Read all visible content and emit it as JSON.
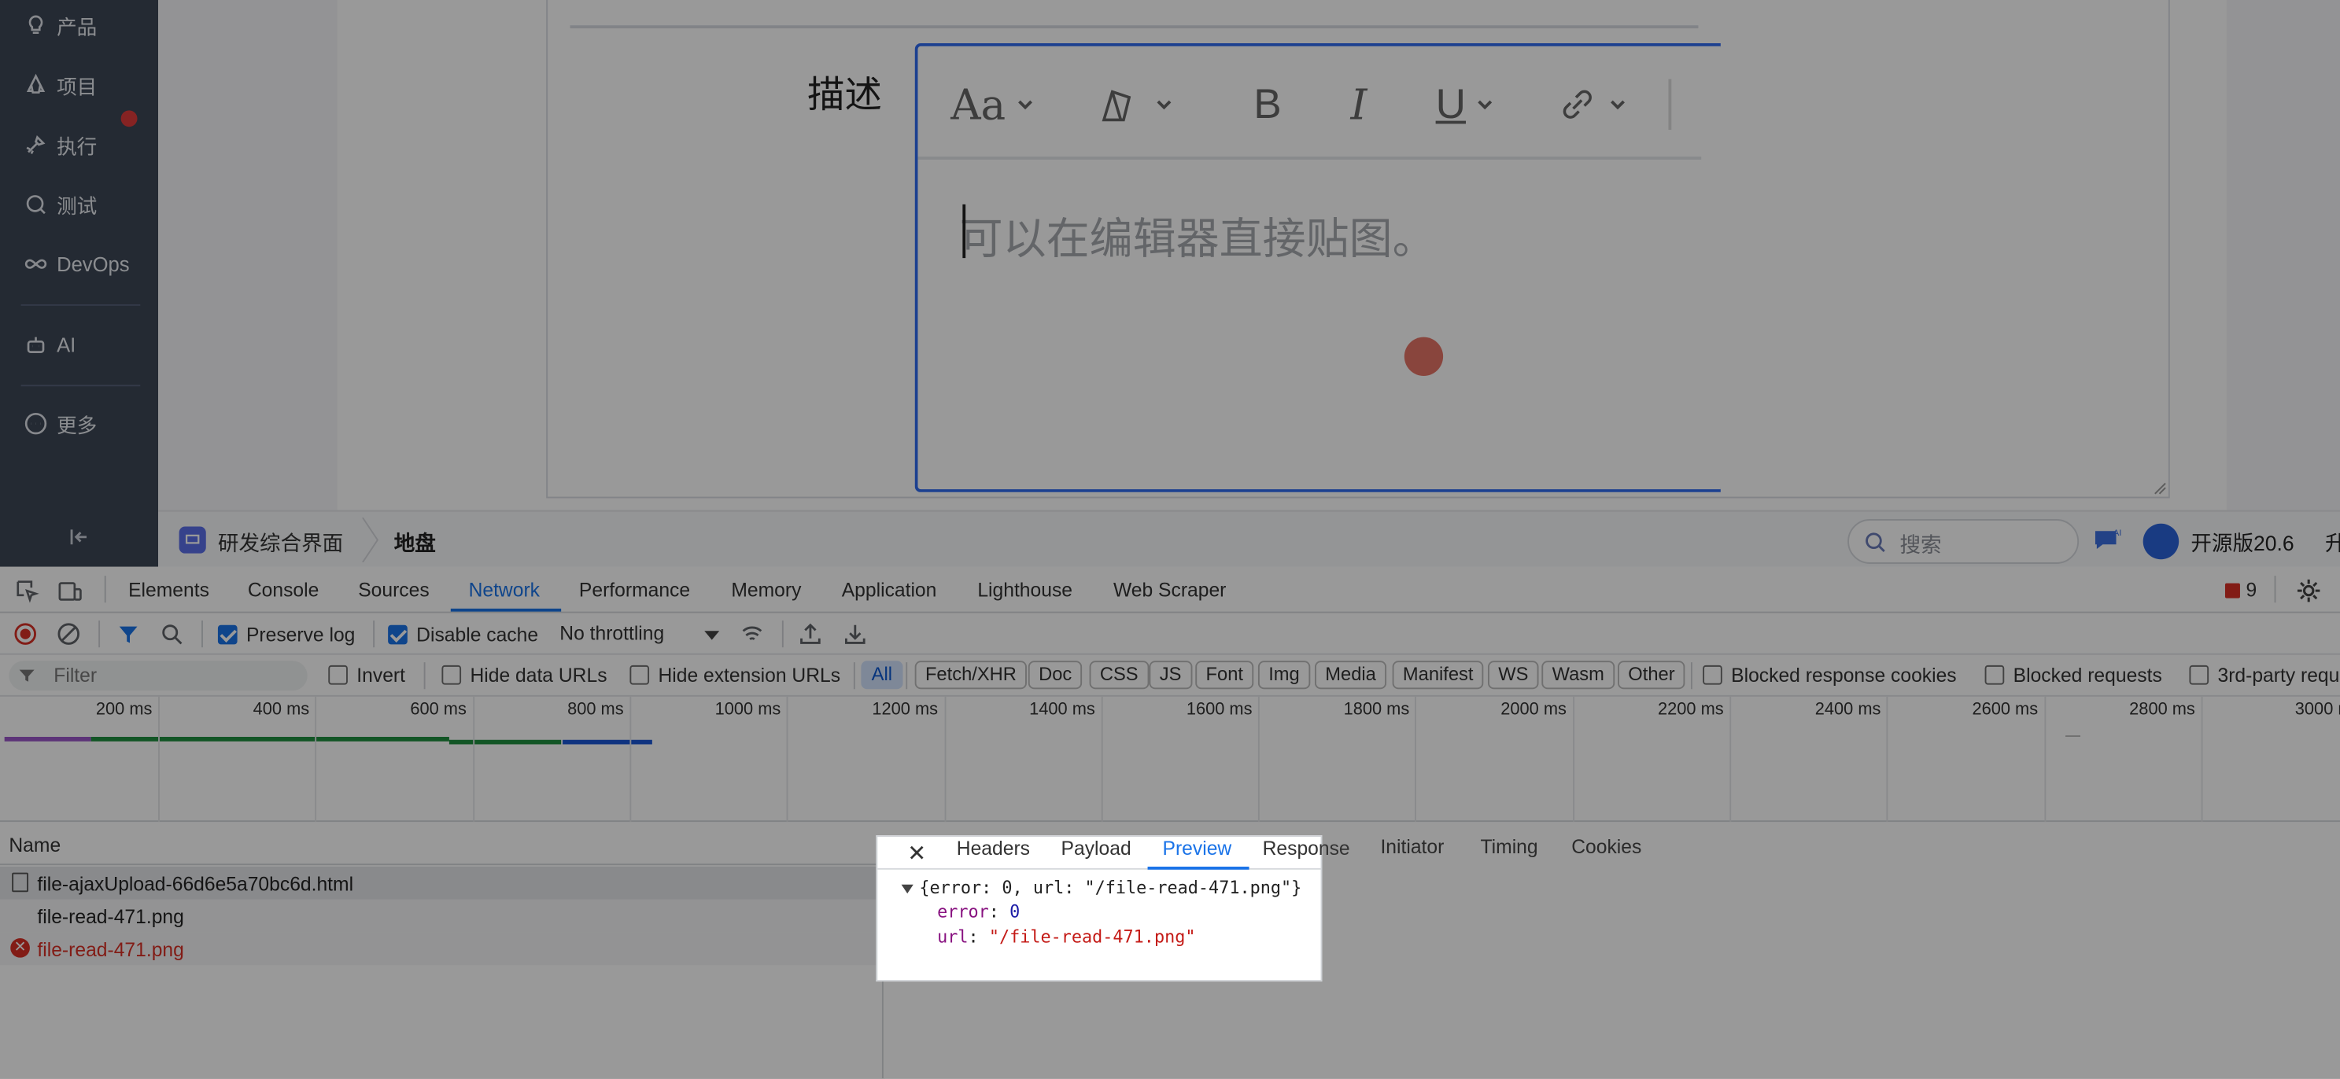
{
  "sidebar": {
    "items": [
      {
        "label": "产品",
        "icon": "bulb-icon"
      },
      {
        "label": "项目",
        "icon": "rocket-icon"
      },
      {
        "label": "执行",
        "icon": "run-icon"
      },
      {
        "label": "测试",
        "icon": "test-icon"
      },
      {
        "label": "DevOps",
        "icon": "infinity-icon"
      },
      {
        "label": "AI",
        "icon": "robot-icon"
      },
      {
        "label": "更多",
        "icon": "more-icon"
      }
    ]
  },
  "form": {
    "description_label": "描述",
    "editor_placeholder": "可以在编辑器直接贴图。",
    "toolbar": {
      "font_glyph": "Aa",
      "bold": "B",
      "italic": "I",
      "underline": "U"
    }
  },
  "statusbar": {
    "workspace": "研发综合界面",
    "current": "地盘",
    "search_placeholder": "搜索",
    "version": "开源版20.6",
    "upgrade": "升"
  },
  "devtools": {
    "tabs": [
      "Elements",
      "Console",
      "Sources",
      "Network",
      "Performance",
      "Memory",
      "Application",
      "Lighthouse",
      "Web Scraper"
    ],
    "active_tab": "Network",
    "error_count": "9",
    "toolbar": {
      "preserve_log": "Preserve log",
      "disable_cache": "Disable cache",
      "throttling": "No throttling"
    },
    "filter": {
      "placeholder": "Filter",
      "invert": "Invert",
      "hide_data_urls": "Hide data URLs",
      "hide_extension_urls": "Hide extension URLs",
      "types": [
        "All",
        "Fetch/XHR",
        "Doc",
        "CSS",
        "JS",
        "Font",
        "Img",
        "Media",
        "Manifest",
        "WS",
        "Wasm",
        "Other"
      ],
      "blocked_response_cookies": "Blocked response cookies",
      "blocked_requests": "Blocked requests",
      "third_party": "3rd-party requ"
    },
    "timeline_ticks": [
      "200 ms",
      "400 ms",
      "600 ms",
      "800 ms",
      "1000 ms",
      "1200 ms",
      "1400 ms",
      "1600 ms",
      "1800 ms",
      "2000 ms",
      "2200 ms",
      "2400 ms",
      "2600 ms",
      "2800 ms",
      "3000 m"
    ],
    "name_header": "Name",
    "requests": [
      {
        "name": "file-ajaxUpload-66d6e5a70bc6d.html",
        "status": "ok"
      },
      {
        "name": "file-read-471.png",
        "status": "ok"
      },
      {
        "name": "file-read-471.png",
        "status": "error"
      }
    ],
    "detail_tabs": [
      "Headers",
      "Payload",
      "Preview",
      "Response",
      "Initiator",
      "Timing",
      "Cookies"
    ],
    "active_detail_tab": "Preview",
    "preview": {
      "summary": "{error: 0, url: \"/file-read-471.png\"}",
      "error_key": "error",
      "error_value": "0",
      "url_key": "url",
      "url_value": "\"/file-read-471.png\""
    }
  },
  "colors": {
    "accent": "#1a73e8",
    "sidebar": "#3d4656",
    "error": "#d93025",
    "editor_border": "#2f6bf0"
  }
}
